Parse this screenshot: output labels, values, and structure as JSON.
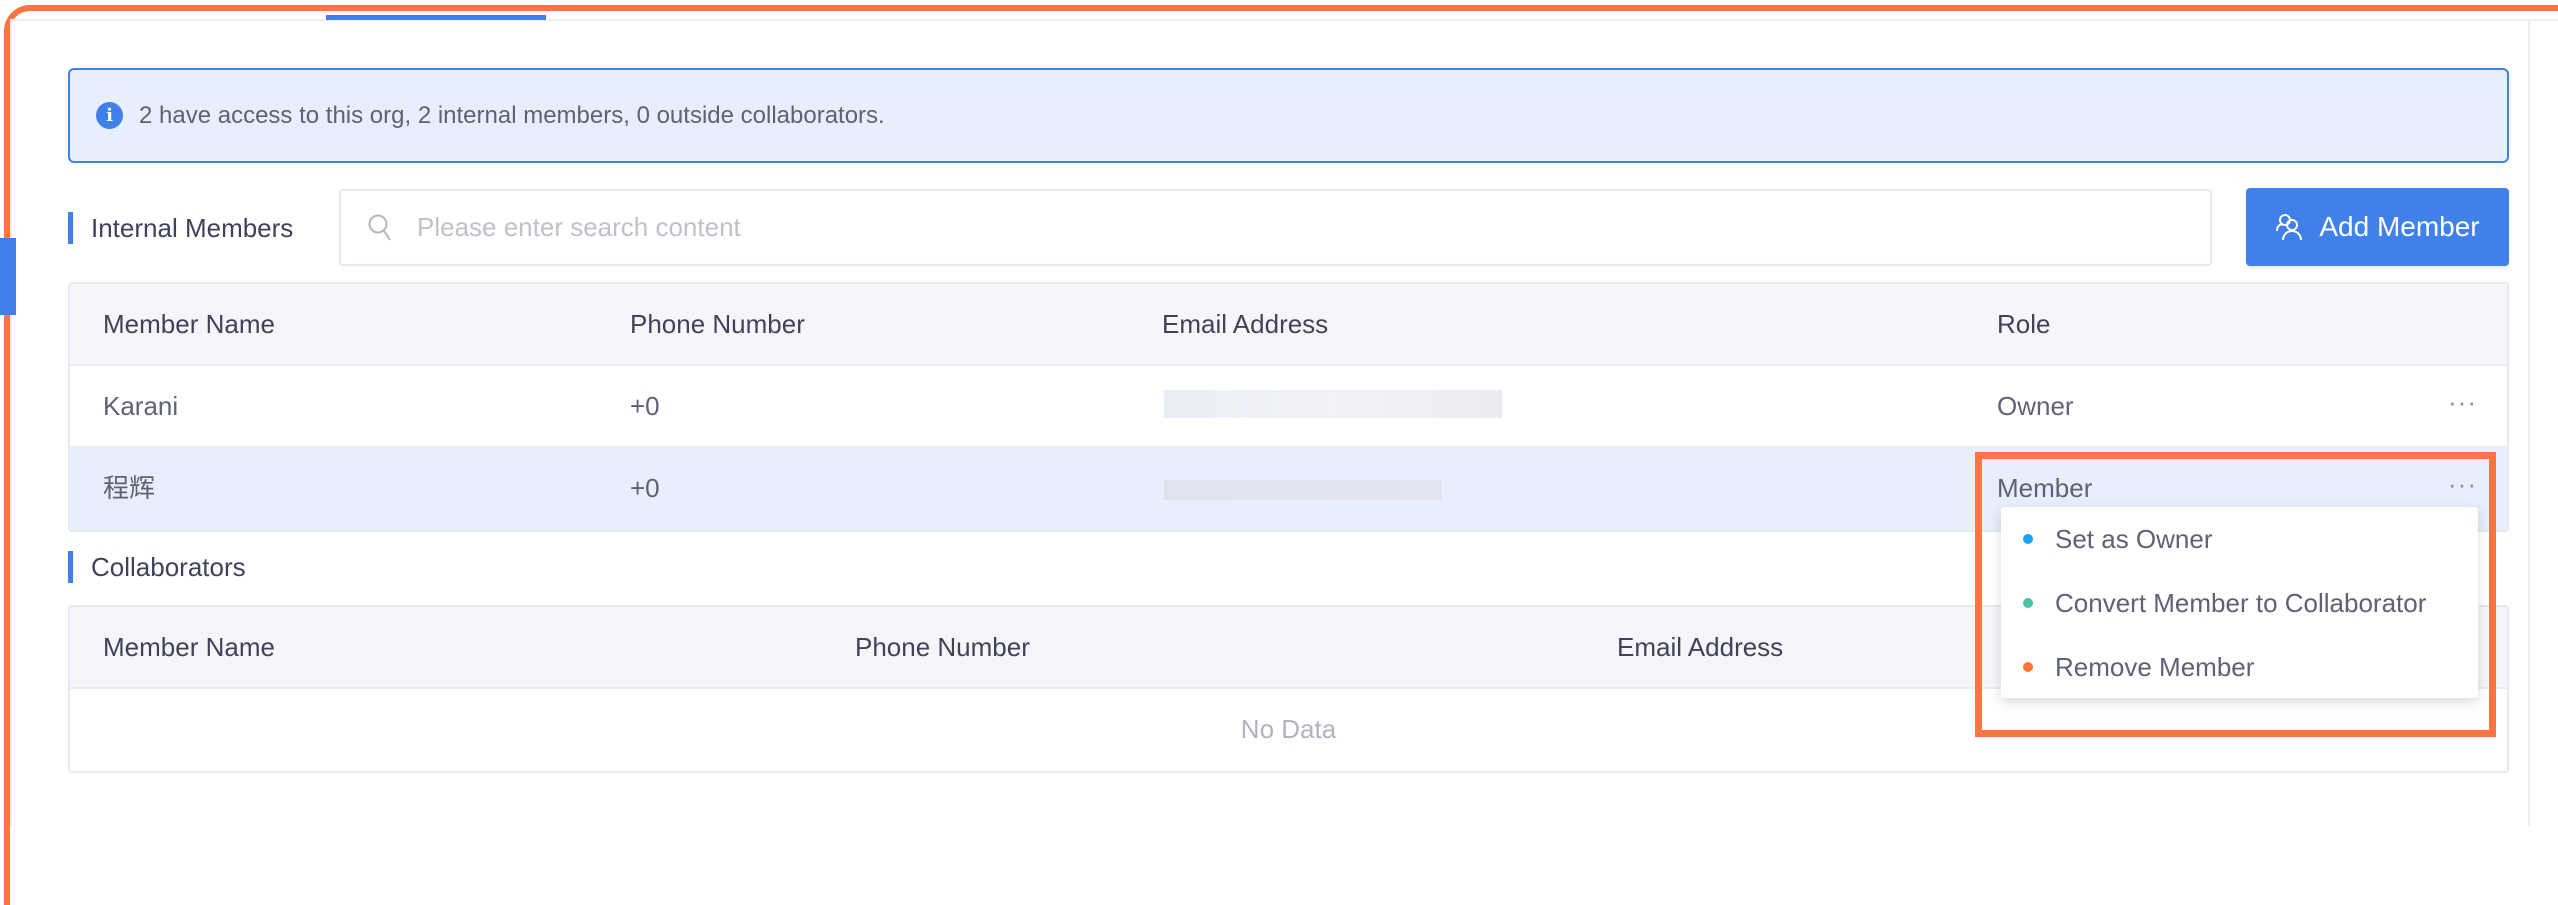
{
  "info_banner": {
    "icon": "info-icon",
    "text": "2 have access to this org, 2 internal members, 0 outside collaborators."
  },
  "internal_members": {
    "title": "Internal Members",
    "search_placeholder": "Please enter search content",
    "search_value": "",
    "add_button_label": "Add Member",
    "columns": [
      "Member Name",
      "Phone Number",
      "Email Address",
      "Role"
    ],
    "rows": [
      {
        "name": "Karani",
        "phone": "+0",
        "email": "",
        "role": "Owner",
        "more": "···"
      },
      {
        "name": "程辉",
        "phone": "+0",
        "email": "",
        "role": "Member",
        "more": "···"
      }
    ]
  },
  "collaborators": {
    "title": "Collaborators",
    "columns": [
      "Member Name",
      "Phone Number",
      "Email Address"
    ],
    "empty_text": "No Data"
  },
  "row_menu": {
    "items": [
      {
        "label": "Set as Owner",
        "color": "#1aa3f5"
      },
      {
        "label": "Convert Member to Collaborator",
        "color": "#4dbfa8"
      },
      {
        "label": "Remove Member",
        "color": "#ff7433"
      }
    ]
  },
  "colors": {
    "accent": "#3f80e9",
    "highlight": "#ff7443",
    "banner_bg": "#e8effc"
  }
}
